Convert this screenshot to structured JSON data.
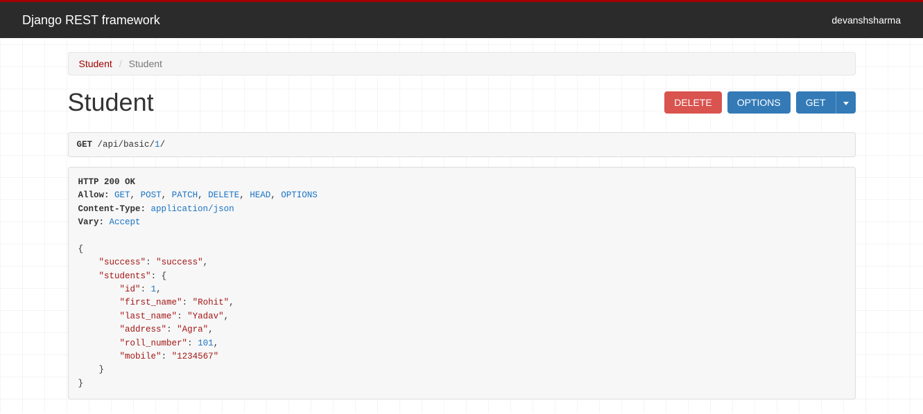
{
  "navbar": {
    "brand": "Django REST framework",
    "user": "devanshsharma"
  },
  "breadcrumb": {
    "root": "Student",
    "current": "Student"
  },
  "page_title": "Student",
  "buttons": {
    "delete": "DELETE",
    "options": "OPTIONS",
    "get": "GET"
  },
  "request": {
    "method": "GET",
    "path_prefix": "/api/basic/",
    "path_id": "1",
    "path_suffix": "/"
  },
  "response": {
    "status_line": "HTTP 200 OK",
    "headers": {
      "allow_label": "Allow:",
      "allow": [
        "GET",
        "POST",
        "PATCH",
        "DELETE",
        "HEAD",
        "OPTIONS"
      ],
      "content_type_label": "Content-Type:",
      "content_type": "application/json",
      "vary_label": "Vary:",
      "vary": "Accept"
    },
    "body": {
      "keys": {
        "success": "success",
        "students": "students",
        "id": "id",
        "first_name": "first_name",
        "last_name": "last_name",
        "address": "address",
        "roll_number": "roll_number",
        "mobile": "mobile"
      },
      "values": {
        "success": "success",
        "id": "1",
        "first_name": "Rohit",
        "last_name": "Yadav",
        "address": "Agra",
        "roll_number": "101",
        "mobile": "1234567"
      }
    }
  }
}
